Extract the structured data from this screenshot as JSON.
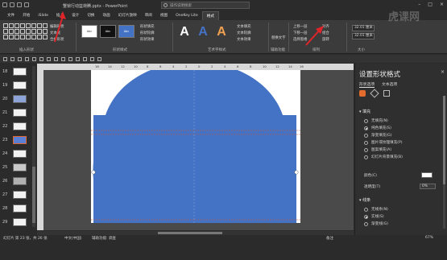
{
  "window": {
    "doc_title": "蟹锁行动篮荷腾.pptx - PowerPoint",
    "search_placeholder": "操作说明搜索",
    "watermark": "虎课网"
  },
  "tabs": [
    "文件",
    "开始",
    "iSlide",
    "插入",
    "设计",
    "切换",
    "动画",
    "幻灯片放映",
    "审阅",
    "视图",
    "OneKey Lite",
    "格式"
  ],
  "active_tab": "格式",
  "ribbon": {
    "insert_shapes_label": "插入形状",
    "edit_shape_label": "编辑形状",
    "textbox_label": "文本框",
    "merge_shapes_label": "合并形状",
    "style_swatches": [
      "Abc",
      "Abc",
      "Abc"
    ],
    "shape_fill_label": "形状填充",
    "shape_outline_label": "形状轮廓",
    "shape_effects_label": "形状效果",
    "shape_styles_group": "形状样式",
    "wordart_letters": [
      "A",
      "A",
      "A"
    ],
    "text_fill_label": "文本填充",
    "text_outline_label": "文本轮廓",
    "text_effects_label": "文本效果",
    "wordart_group": "艺术字样式",
    "alt_text_label": "替换文字",
    "accessibility_group": "辅助功能",
    "bring_forward_label": "上移一层",
    "send_backward_label": "下移一层",
    "selection_pane_label": "选择窗格",
    "align_label": "对齐",
    "group_label": "组合",
    "rotate_label": "旋转",
    "arrange_group": "排列",
    "height_value": "32.01 厘米",
    "width_value": "32.01 厘米",
    "size_group": "大小"
  },
  "thumbnails": [
    {
      "num": "18"
    },
    {
      "num": "19"
    },
    {
      "num": "20"
    },
    {
      "num": "21"
    },
    {
      "num": "22"
    },
    {
      "num": "23"
    },
    {
      "num": "24"
    },
    {
      "num": "25"
    },
    {
      "num": "26"
    },
    {
      "num": "27"
    },
    {
      "num": "28"
    },
    {
      "num": "29"
    }
  ],
  "selected_thumbnail": "23",
  "ruler_ticks": [
    "16",
    "14",
    "12",
    "10",
    "8",
    "6",
    "4",
    "2",
    "0",
    "2",
    "4",
    "6",
    "8",
    "10",
    "12",
    "14",
    "16"
  ],
  "format_pane": {
    "title": "设置形状格式",
    "tab_shape_options": "形状选项",
    "tab_text_options": "文本选项",
    "close": "×",
    "fill_section": "填充",
    "fill_options": [
      "无填充(N)",
      "纯色填充(S)",
      "渐变填充(G)",
      "图片或纹理填充(P)",
      "图案填充(A)",
      "幻灯片背景填充(B)"
    ],
    "fill_selected": "纯色填充(S)",
    "color_label": "颜色(C)",
    "transparency_label": "透明度(T)",
    "transparency_value": "0%",
    "line_section": "线条",
    "line_options": [
      "无线条(N)",
      "实线(S)",
      "渐变线(G)"
    ],
    "line_selected": "实线(S)"
  },
  "status": {
    "slide_info": "幻灯片 第 23 张，共 26 张",
    "language": "中文(中国)",
    "accessibility": "辅助功能: 调查",
    "notes": "备注",
    "zoom": "67%"
  },
  "colors": {
    "shape_blue": "#4472c4",
    "accent_orange": "#d6572a",
    "arrow_red": "#e0252a"
  }
}
